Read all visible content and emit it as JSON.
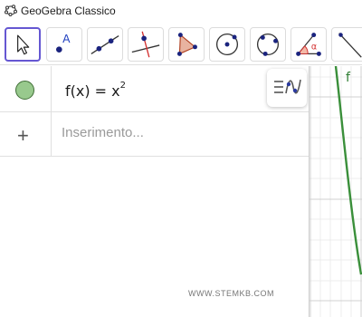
{
  "window": {
    "title": "GeoGebra Classico"
  },
  "toolbar": {
    "tools": [
      {
        "name": "move",
        "active": true
      },
      {
        "name": "point"
      },
      {
        "name": "line"
      },
      {
        "name": "perpendicular-line"
      },
      {
        "name": "polygon"
      },
      {
        "name": "circle-center-point"
      },
      {
        "name": "circle-three-points"
      },
      {
        "name": "angle"
      },
      {
        "name": "reflect"
      }
    ],
    "point_label": "A",
    "angle_label": "α"
  },
  "algebra": {
    "rows": [
      {
        "type": "function",
        "fn": "f(x) = x",
        "exponent": "2",
        "color": "#98c98d"
      }
    ],
    "input_placeholder": "Inserimento...",
    "add_symbol": "+"
  },
  "graphics": {
    "function_label": "f",
    "curve_color": "#3a8f3a"
  },
  "watermark": "WWW.STEMKB.COM"
}
